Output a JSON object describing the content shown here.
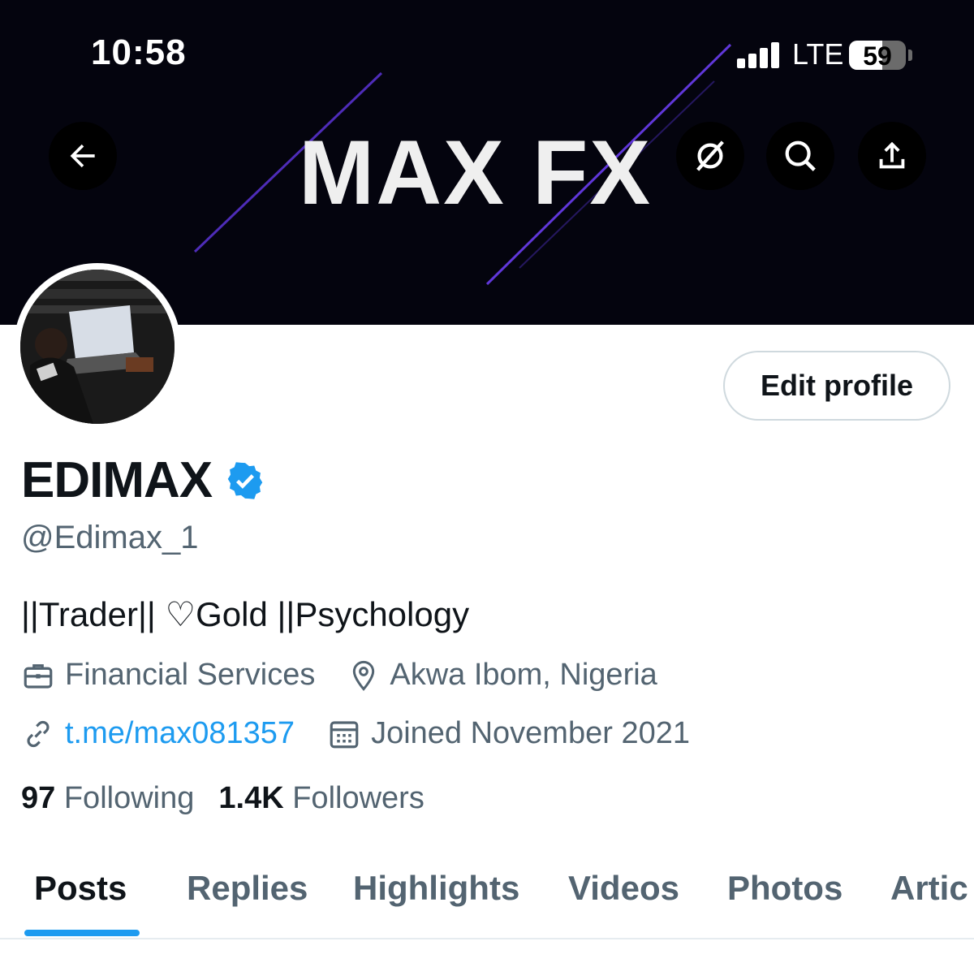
{
  "status_bar": {
    "time": "10:58",
    "network": "LTE",
    "battery_percent": 59,
    "battery_label": "59",
    "signal_bars": 4
  },
  "banner": {
    "title": "MAX FX",
    "background_color": "#04040e",
    "streak_color": "#6a3df0"
  },
  "header_actions": {
    "back_icon": "arrow-left-icon",
    "grok_icon": "grok-icon",
    "search_icon": "search-icon",
    "share_icon": "share-icon"
  },
  "profile": {
    "edit_button_label": "Edit profile",
    "display_name": "EDIMAX",
    "verified": true,
    "handle": "@Edimax_1",
    "bio": "||Trader|| ♡Gold ||Psychology",
    "category": "Financial Services",
    "location": "Akwa Ibom, Nigeria",
    "link": "t.me/max081357",
    "joined": "Joined November 2021",
    "following_count": "97",
    "following_label": "Following",
    "followers_count": "1.4K",
    "followers_label": "Followers"
  },
  "tabs": [
    {
      "label": "Posts",
      "active": true
    },
    {
      "label": "Replies",
      "active": false
    },
    {
      "label": "Highlights",
      "active": false
    },
    {
      "label": "Videos",
      "active": false
    },
    {
      "label": "Photos",
      "active": false
    },
    {
      "label": "Artic",
      "active": false
    }
  ],
  "colors": {
    "accent": "#1d9bf0",
    "text_primary": "#0f1419",
    "text_secondary": "#536471"
  }
}
